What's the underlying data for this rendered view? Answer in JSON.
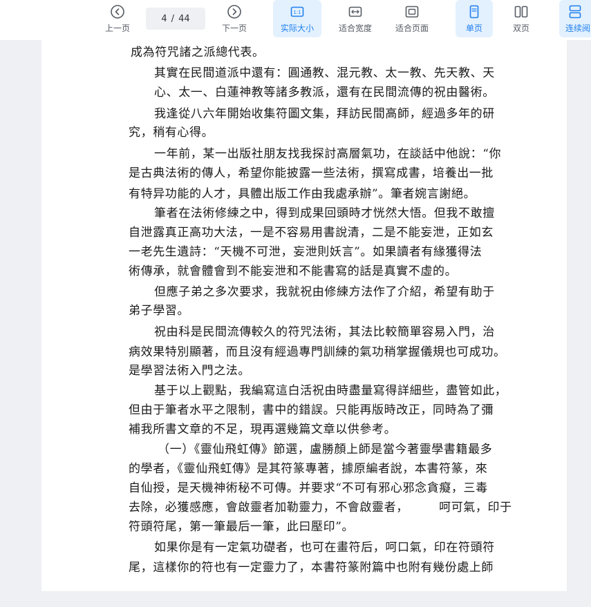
{
  "toolbar": {
    "prev_label": "上一页",
    "page_current": "4",
    "page_separator": "/",
    "page_total": "44",
    "next_label": "下一页",
    "actual_size_label": "实际大小",
    "actual_size_icon_text": "1:1",
    "fit_width_label": "适合宽度",
    "fit_page_label": "适合页面",
    "single_page_label": "单页",
    "double_page_label": "双页",
    "continuous_label": "连续阅"
  },
  "document": {
    "lines": [
      "成為符咒諸之派總代表。",
      "其實在民間道派中還有：圓通教、混元教、太一教、先天教、天",
      "心、太一、白蓮神教等諸多教派，還有在民間流傳的祝由醫術。",
      "我逢從八六年開始收集符圖文集，拜訪民間高師，經過多年的研",
      "究，稍有心得。",
      "一年前，某一出版社朋友找我探討高層氣功，在談話中他說：“你",
      "是古典法術的傳人，希望你能披露一些法術，撰寫成書，培養出一批",
      "有特异功能的人才，具體出版工作由我處承辦”。筆者婉言謝絕。",
      "筆者在法術修練之中，得到成果回頭時才恍然大悟。但我不敢擅",
      "自泄露真正高功大法，一是不容易用書說清，二是不能妄泄，正如玄",
      "一老先生遺詩：“天機不可泄，妄泄則妖言”。如果讀者有緣獲得法",
      "術傳承，就會體會到不能妄泄和不能書寫的話是真實不虛的。",
      "但應子弟之多次要求，我就祝由修練方法作了介紹，希望有助于",
      "弟子學習。",
      "祝由科是民間流傳較久的符咒法術，其法比較簡單容易入門，治",
      "病效果特別顯著，而且沒有經過專門訓練的氣功稍掌握儀規也可成功。",
      "是學習法術入門之法。",
      "基于以上觀點，我編寫這白活祝由時盡量寫得詳細些，盡管如此，",
      "但由于筆者水平之限制，書中的錯誤。只能再版時改正，同時為了彌",
      "補我所書文章的不足，現再選幾篇文章以供參考。",
      "（一）《靈仙飛虹傳》節選，盧勝顏上師是當今著靈學書籍最多",
      "的學者，《靈仙飛虹傳》是其符篆專著，據原編者說，本書符篆，來",
      "自仙授，是天機神術秘不可傳。并要求“不可有邪心邪念貪癡，三毒",
      "去除，必獲感應，會啟靈者加勒靈力，不會啟靈者，　　　呵可氣，印于",
      "符頭符尾，第一筆最后一筆，此曰壓印”。",
      "如果你是有一定氣功礎者，也可在畫符后，呵口氣，印在符頭符",
      "尾，這樣你的符也有一定靈力了，本書符篆附篇中也附有幾份處上師"
    ]
  }
}
